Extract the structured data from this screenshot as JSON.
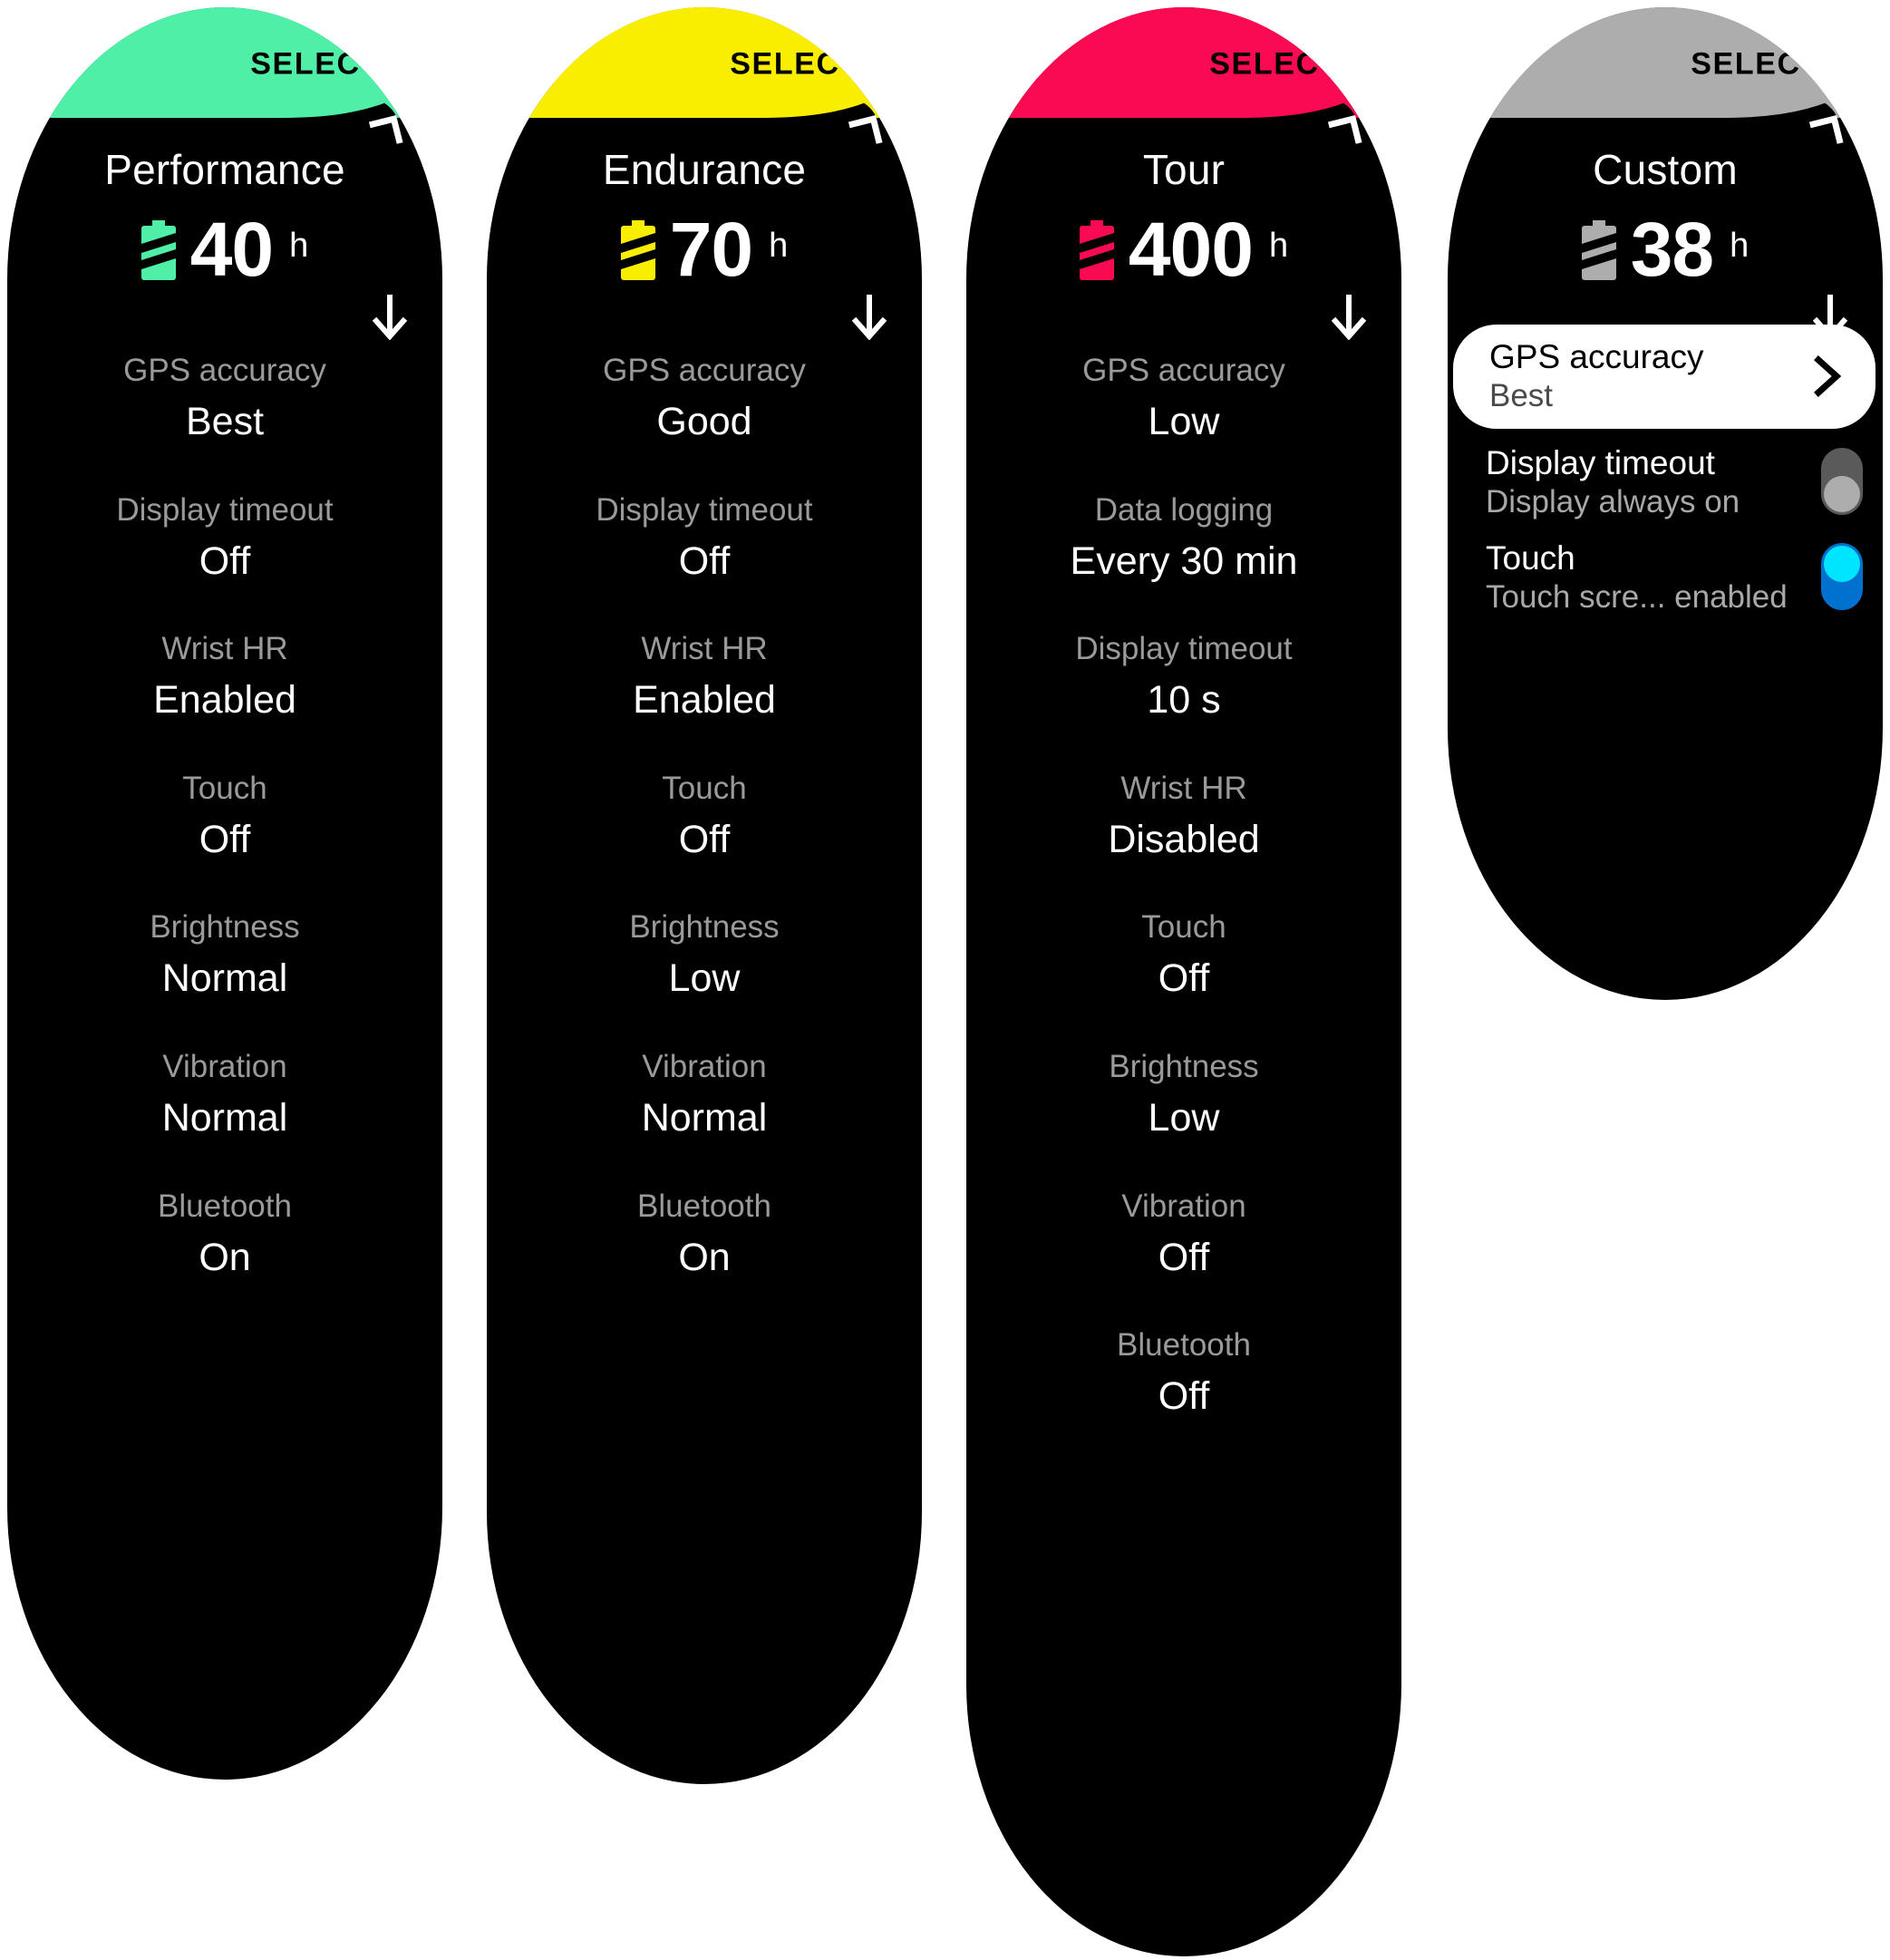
{
  "page": {
    "background": "#ffffff",
    "screen_background": "#000000",
    "label_color": "#9a9a9a",
    "value_color": "#ffffff"
  },
  "select_label": "SELECT",
  "battery_unit": "h",
  "icons": {
    "battery": "battery-icon",
    "corner": "corner-arrow-icon",
    "scroll_down": "down-arrow-icon",
    "chevron": "chevron-right-icon"
  },
  "cards": [
    {
      "id": "performance",
      "accent": "#4FEFA8",
      "title": "Performance",
      "battery_hours": "40",
      "rows": [
        {
          "label": "GPS accuracy",
          "value": "Best"
        },
        {
          "label": "Display timeout",
          "value": "Off"
        },
        {
          "label": "Wrist HR",
          "value": "Enabled"
        },
        {
          "label": "Touch",
          "value": "Off"
        },
        {
          "label": "Brightness",
          "value": "Normal"
        },
        {
          "label": "Vibration",
          "value": "Normal"
        },
        {
          "label": "Bluetooth",
          "value": "On"
        }
      ]
    },
    {
      "id": "endurance",
      "accent": "#FAEE00",
      "title": "Endurance",
      "battery_hours": "70",
      "rows": [
        {
          "label": "GPS accuracy",
          "value": "Good"
        },
        {
          "label": "Display timeout",
          "value": "Off"
        },
        {
          "label": "Wrist HR",
          "value": "Enabled"
        },
        {
          "label": "Touch",
          "value": "Off"
        },
        {
          "label": "Brightness",
          "value": "Low"
        },
        {
          "label": "Vibration",
          "value": "Normal"
        },
        {
          "label": "Bluetooth",
          "value": "On"
        }
      ]
    },
    {
      "id": "tour",
      "accent": "#FA0A50",
      "title": "Tour",
      "battery_hours": "400",
      "rows": [
        {
          "label": "GPS accuracy",
          "value": "Low"
        },
        {
          "label": "Data logging",
          "value": "Every 30 min"
        },
        {
          "label": "Display timeout",
          "value": "10 s"
        },
        {
          "label": "Wrist HR",
          "value": "Disabled"
        },
        {
          "label": "Touch",
          "value": "Off"
        },
        {
          "label": "Brightness",
          "value": "Low"
        },
        {
          "label": "Vibration",
          "value": "Off"
        },
        {
          "label": "Bluetooth",
          "value": "Off"
        }
      ]
    },
    {
      "id": "custom",
      "accent": "#ADADAD",
      "title": "Custom",
      "battery_hours": "38",
      "list": [
        {
          "label": "GPS accuracy",
          "value": "Best",
          "control": "chevron",
          "highlighted": true
        },
        {
          "label": "Display timeout",
          "value": "Display always on",
          "control": "toggle",
          "toggle_state": "off",
          "toggle_track_color": "#5a5a5a",
          "toggle_knob_color": "#adadad",
          "highlighted": false
        },
        {
          "label": "Touch",
          "value": "Touch scre... enabled",
          "control": "toggle",
          "toggle_state": "on",
          "toggle_track_color": "#0071CE",
          "toggle_knob_color": "#00E5FF",
          "highlighted": false
        }
      ]
    }
  ]
}
